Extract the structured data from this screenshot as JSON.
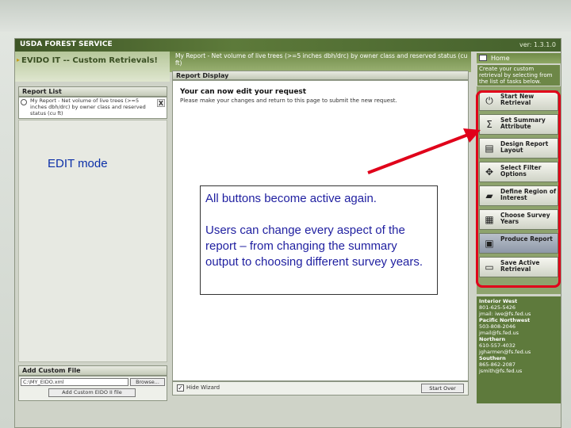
{
  "banner": {
    "title": "USDA FOREST SERVICE",
    "version": "ver: 1.3.1.0"
  },
  "app": {
    "title": "EVIDO IT -- Custom Retrievals!",
    "report_name": "My Report - Net volume of live trees (>=5 inches dbh/drc) by owner class and reserved status (cu ft)"
  },
  "report_list": {
    "header": "Report List",
    "item_text": "My Report - Net volume of live trees (>=5 inches dbh/drc) by owner class and reserved status (cu ft)",
    "close_label": "X"
  },
  "add_custom_file": {
    "header": "Add Custom File",
    "input_value": "C:\\MY_EIDO.xml",
    "browse_label": "Browse...",
    "add_label": "Add Custom EIDO II file"
  },
  "report_display": {
    "header": "Report Display",
    "title": "Your can now edit your request",
    "instruction": "Please make your changes and return to this page to submit the new request.",
    "hide_label": "Hide Wizard",
    "hide_checked": "✓",
    "start_over_label": "Start Over"
  },
  "right_panel": {
    "home_label": "Home",
    "intro": "Create your custom retrieval by selecting from the list of tasks below.",
    "tasks": [
      {
        "label": "Start New Retrieval",
        "icon": "power-icon",
        "glyph": "⏻"
      },
      {
        "label": "Set Summary Attribute",
        "icon": "sigma-icon",
        "glyph": "Σ"
      },
      {
        "label": "Design Report Layout",
        "icon": "layout-icon",
        "glyph": "▤"
      },
      {
        "label": "Select Filter Options",
        "icon": "filter-icon",
        "glyph": "✥"
      },
      {
        "label": "Define Region of Interest",
        "icon": "map-icon",
        "glyph": "▰"
      },
      {
        "label": "Choose Survey Years",
        "icon": "calendar-icon",
        "glyph": "▦"
      },
      {
        "label": "Produce Report",
        "icon": "report-icon",
        "glyph": "▣"
      },
      {
        "label": "Save Active Retrieval",
        "icon": "save-icon",
        "glyph": "▭"
      }
    ],
    "contacts": [
      {
        "region": "Interior West",
        "phone": "801-625-5426",
        "email": "jmail: iwe@fs.fed.us"
      },
      {
        "region": "Pacific Northwest",
        "phone": "503-808-2046",
        "email": "jmail@fs.fed.us"
      },
      {
        "region": "Northern",
        "phone": "610-557-4032",
        "email": "jgharmen@fs.fed.us"
      },
      {
        "region": "Southern",
        "phone": "865-862-2087",
        "email": "jsmith@fs.fed.us"
      }
    ]
  },
  "annotations": {
    "edit_mode": "EDIT mode",
    "callout_line1": "All buttons become active again.",
    "callout_line2": "Users can change every aspect of the report – from changing the summary output to choosing different survey years.",
    "highlight_color": "#e0001a"
  }
}
